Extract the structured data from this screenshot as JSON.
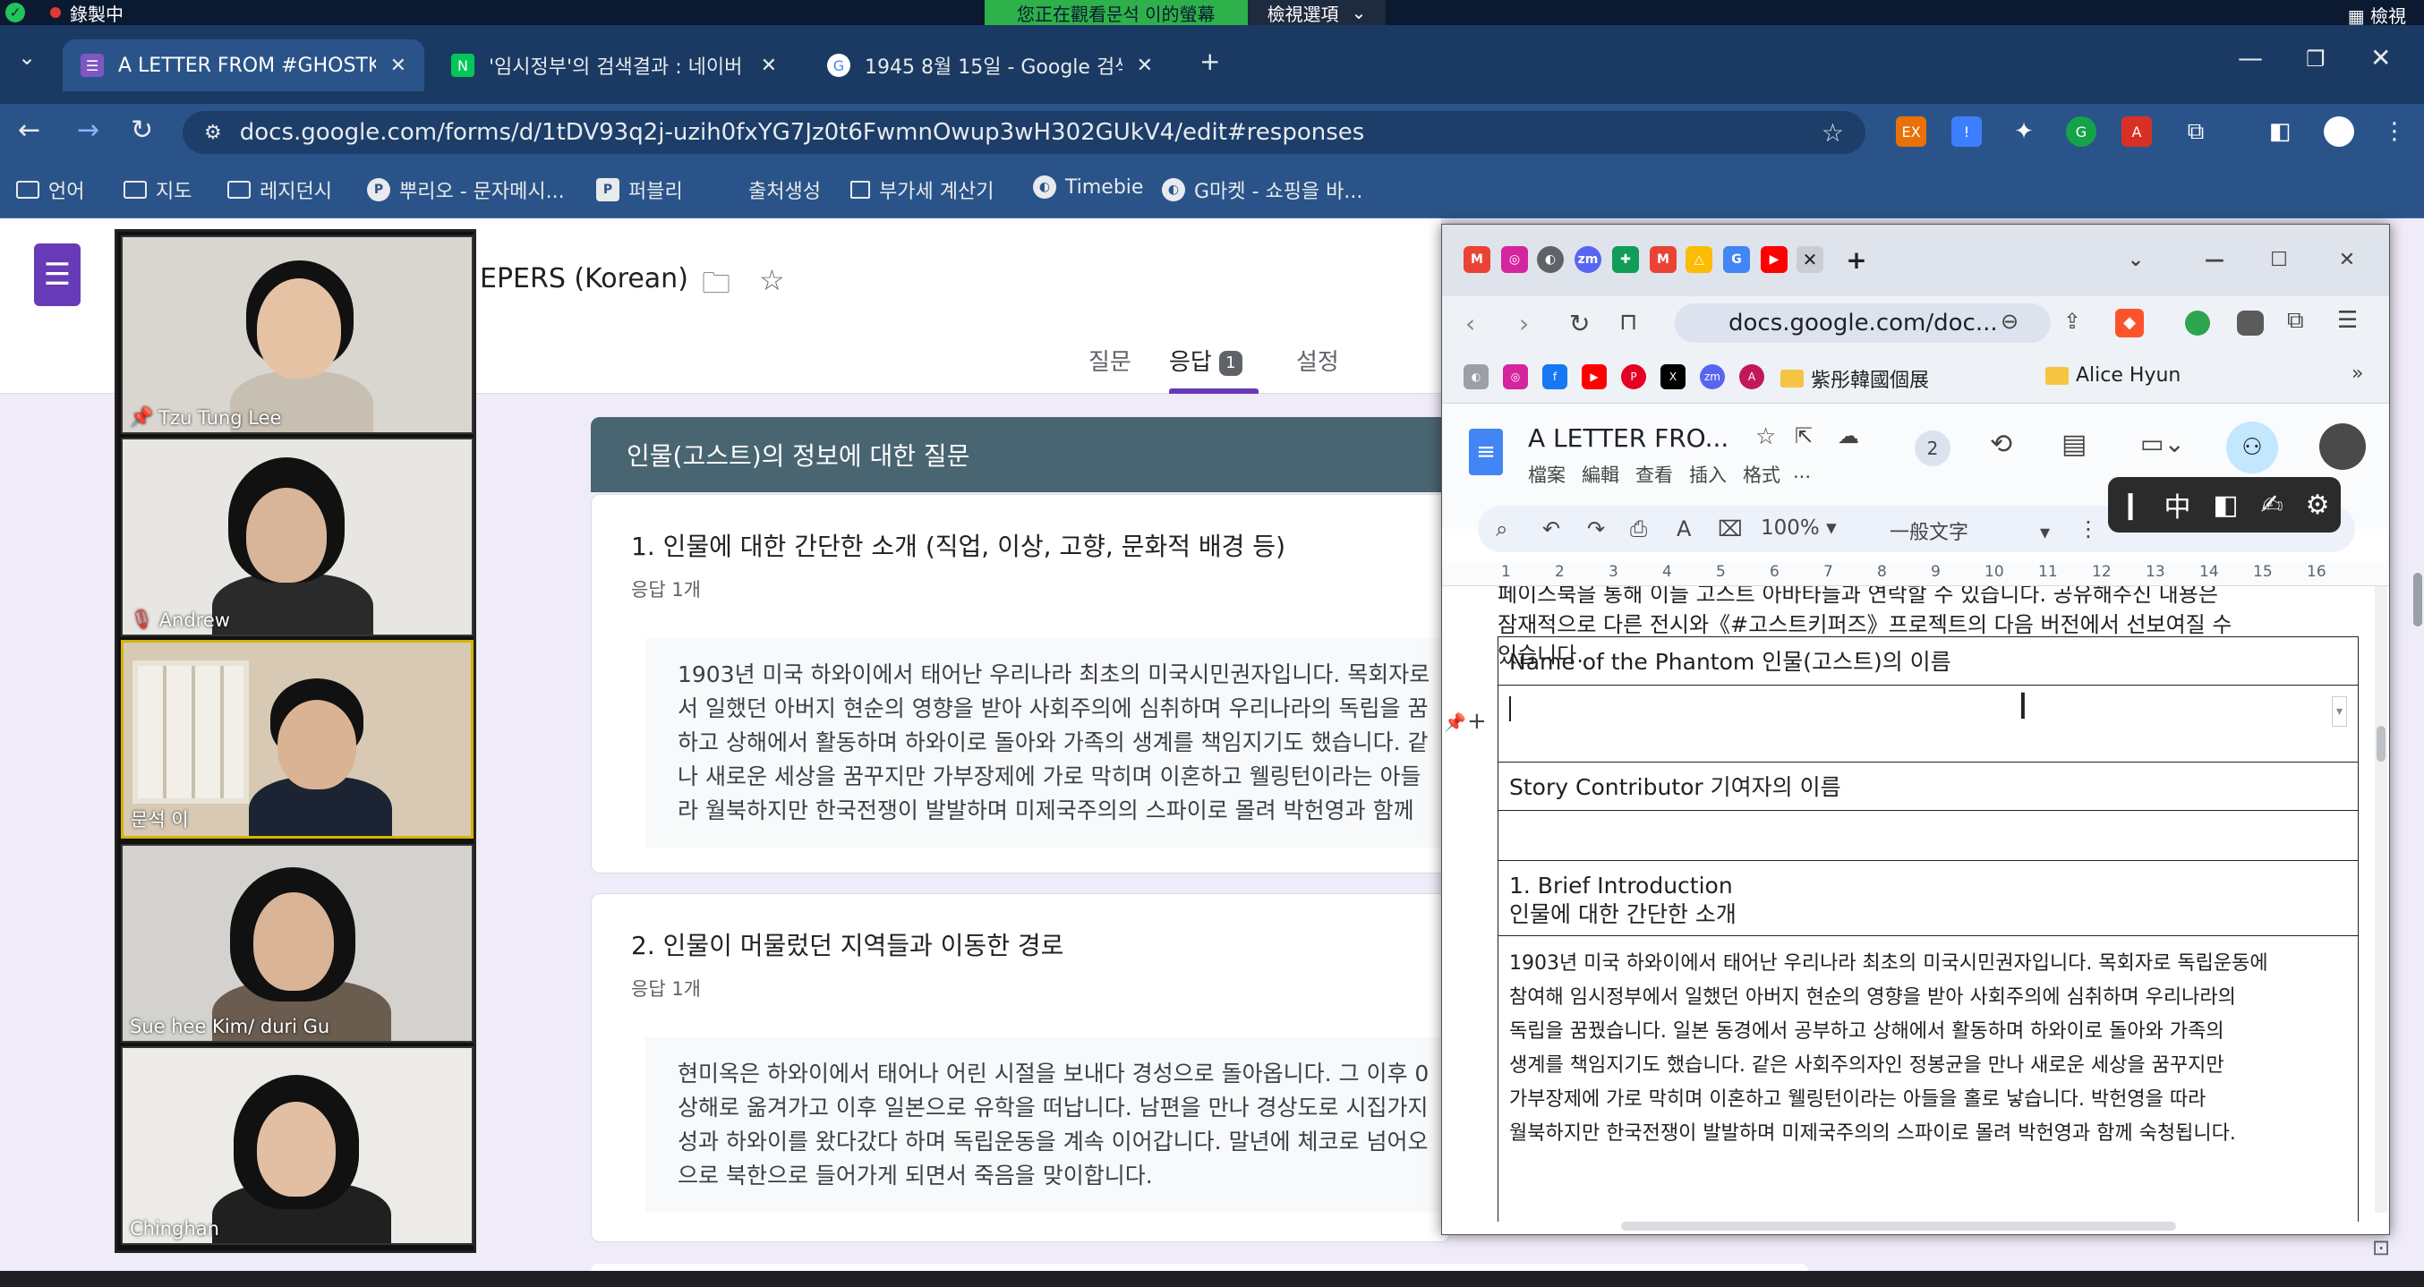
{
  "status_bar": {
    "recording": "錄製中",
    "viewing_label": "您正在觀看문석 이的螢幕",
    "view_options": "檢視選項",
    "check": "檢視"
  },
  "browser": {
    "tabs": [
      {
        "title": "A LETTER FROM #GHOSTKEEPERS (Korean)",
        "close": "✕"
      },
      {
        "title": "'임시정부'의 검색결과 : 네이버",
        "close": "✕"
      },
      {
        "title": "1945 8월 15일 - Google 검색",
        "close": "✕"
      }
    ],
    "new_tab": "+",
    "url": "docs.google.com/forms/d/1tDV93q2j-uzih0fxYG7Jz0t6FwmnOwup3wH302GUkV4/edit#responses",
    "bookmarks": [
      "언어",
      "지도",
      "레지던시",
      "뿌리오 - 문자메시...",
      "퍼블리",
      "출처생성",
      "부가세 계산기",
      "Timebie",
      "G마켓 - 쇼핑을 바..."
    ]
  },
  "form": {
    "title": "EPERS (Korean)",
    "tabs": {
      "questions": "질문",
      "responses": "응답",
      "responses_count": "1",
      "settings": "설정"
    },
    "section_title": "인물(고스트)의 정보에 대한 질문",
    "questions": [
      {
        "title": "1. 인물에 대한 간단한 소개 (직업, 이상, 고향, 문화적 배경 등)",
        "count": "응답 1개",
        "answer_lines": [
          "1903년 미국 하와이에서 태어난 우리나라 최초의 미국시민권자입니다. 목회자로",
          "서 일했던 아버지 현순의 영향을 받아 사회주의에 심취하며 우리나라의 독립을 꿈",
          "하고 상해에서 활동하며 하와이로 돌아와 가족의 생계를 책임지기도 했습니다. 같",
          "나 새로운 세상을 꿈꾸지만 가부장제에 가로 막히며 이혼하고 웰링턴이라는 아들",
          "라 월북하지만 한국전쟁이 발발하며 미제국주의의 스파이로 몰려 박헌영과 함께"
        ]
      },
      {
        "title": "2. 인물이 머물렀던 지역들과 이동한 경로",
        "count": "응답 1개",
        "answer_lines": [
          "현미옥은 하와이에서 태어나 어린 시절을 보내다 경성으로 돌아옵니다. 그 이후 0",
          "상해로 옮겨가고 이후 일본으로 유학을 떠납니다. 남편을 만나 경상도로 시집가지",
          "성과 하와이를 왔다갔다 하며 독립운동을 계속 이어갑니다. 말년에 체코로 넘어오",
          "으로 북한으로 들어가게 되면서 죽음을 맞이합니다."
        ]
      }
    ]
  },
  "video": {
    "participants": [
      "Tzu Tung Lee",
      "Andrew",
      "문석 이",
      "Sue hee Kim/ duri Gu",
      "Chinghan"
    ]
  },
  "doc_window": {
    "url": "docs.google.com/doc...",
    "bookmark_labels": [
      "紫彤韓國個展",
      "Alice Hyun"
    ],
    "title": "A LETTER FRO...",
    "menus": [
      "檔案",
      "編輯",
      "查看",
      "插入",
      "格式",
      "..."
    ],
    "avatar_count": "2",
    "zoom": "100%",
    "style": "一般文字",
    "ime": [
      "中"
    ],
    "ruler_numbers": [
      "1",
      "2",
      "3",
      "4",
      "5",
      "6",
      "7",
      "8",
      "9",
      "10",
      "11",
      "12",
      "13",
      "14",
      "15",
      "16"
    ],
    "intro_lines": [
      "페이스북을 통해 이들 고스트 아바타들과 연락할 수 있습니다. 공유해주신 내용은",
      "잠재적으로 다른 전시와《#고스트키퍼즈》프로젝트의 다음 버전에서 선보여질 수",
      "있습니다."
    ],
    "table": {
      "phantom_name_label": "Name of the Phantom 인물(고스트)의 이름",
      "contributor_label": "Story Contributor 기여자의 이름",
      "brief_intro_en": "1. Brief Introduction",
      "brief_intro_ko": "인물에 대한 간단한 소개",
      "intro_answer_lines": [
        "1903년 미국 하와이에서 태어난 우리나라 최초의 미국시민권자입니다. 목회자로 독립운동에",
        "참여해 임시정부에서 일했던 아버지 현순의 영향을 받아 사회주의에 심취하며 우리나라의",
        "독립을 꿈꿨습니다. 일본 동경에서 공부하고 상해에서 활동하며 하와이로 돌아와 가족의",
        "생계를 책임지기도 했습니다. 같은 사회주의자인 정봉균을 만나 새로운 세상을 꿈꾸지만",
        "가부장제에 가로 막히며 이혼하고 웰링턴이라는 아들을 홀로 낳습니다. 박헌영을 따라",
        "월북하지만 한국전쟁이 발발하며 미제국주의의 스파이로 몰려 박헌영과 함께 숙청됩니다."
      ]
    }
  },
  "colors": {
    "tab_bar": "#1a3a63",
    "forms_purple": "#673ab7",
    "section_header": "#4a6572"
  }
}
